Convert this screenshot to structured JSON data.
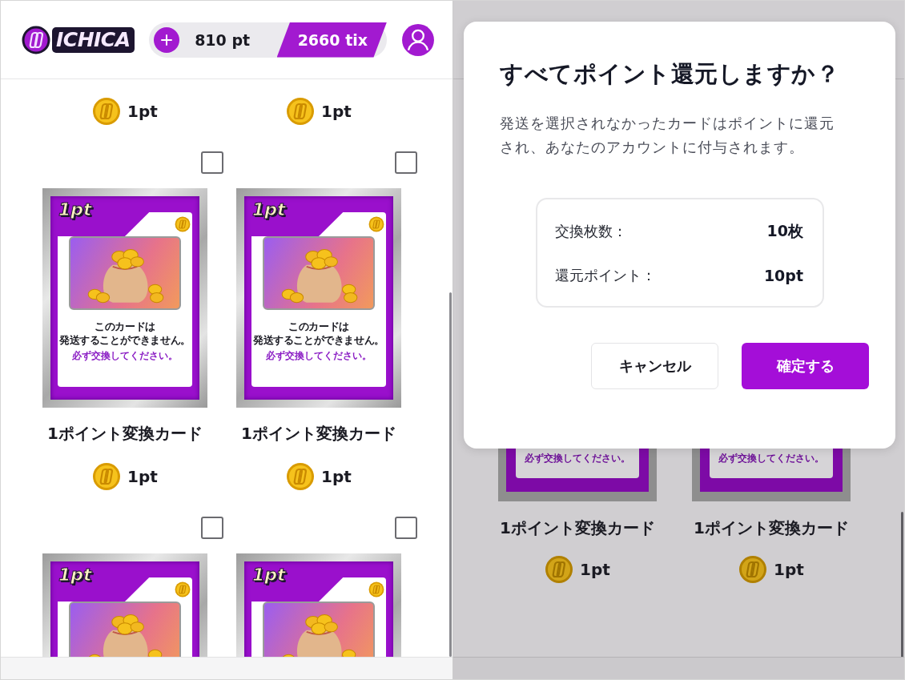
{
  "left_screen": {
    "header": {
      "logo_text": "ICHICA",
      "points": "810 pt",
      "tickets": "2660 tix"
    },
    "items": [
      {
        "price": "1pt"
      },
      {
        "price": "1pt"
      },
      {
        "checked": false,
        "card": {
          "badge": "1pt",
          "line_1": "このカードは",
          "line_2": "発送することができません。",
          "notice": "必ず交換してください。"
        },
        "name": "1ポイント変換カード",
        "price": "1pt"
      },
      {
        "checked": false,
        "card": {
          "badge": "1pt",
          "line_1": "このカードは",
          "line_2": "発送することができません。",
          "notice": "必ず交換してください。"
        },
        "name": "1ポイント変換カード",
        "price": "1pt"
      },
      {
        "checked": false,
        "card": {
          "badge": "1pt"
        }
      },
      {
        "checked": false,
        "card": {
          "badge": "1pt"
        }
      }
    ]
  },
  "right_screen": {
    "items": [
      {
        "card": {
          "notice": "必ず交換してください。"
        },
        "name": "1ポイント変換カード",
        "price": "1pt"
      },
      {
        "card": {
          "notice": "必ず交換してください。"
        },
        "name": "1ポイント変換カード",
        "price": "1pt"
      }
    ],
    "dialog": {
      "title": "すべてポイント還元しますか？",
      "message": "発送を選択されなかったカードはポイントに還元され、あなたのアカウントに付与されます。",
      "summary": [
        {
          "label": "交換枚数：",
          "value": "10枚"
        },
        {
          "label": "還元ポイント：",
          "value": "10pt"
        }
      ],
      "buttons": [
        {
          "label": "キャンセル",
          "kind": "secondary"
        },
        {
          "label": "確定する",
          "kind": "primary"
        }
      ]
    }
  }
}
